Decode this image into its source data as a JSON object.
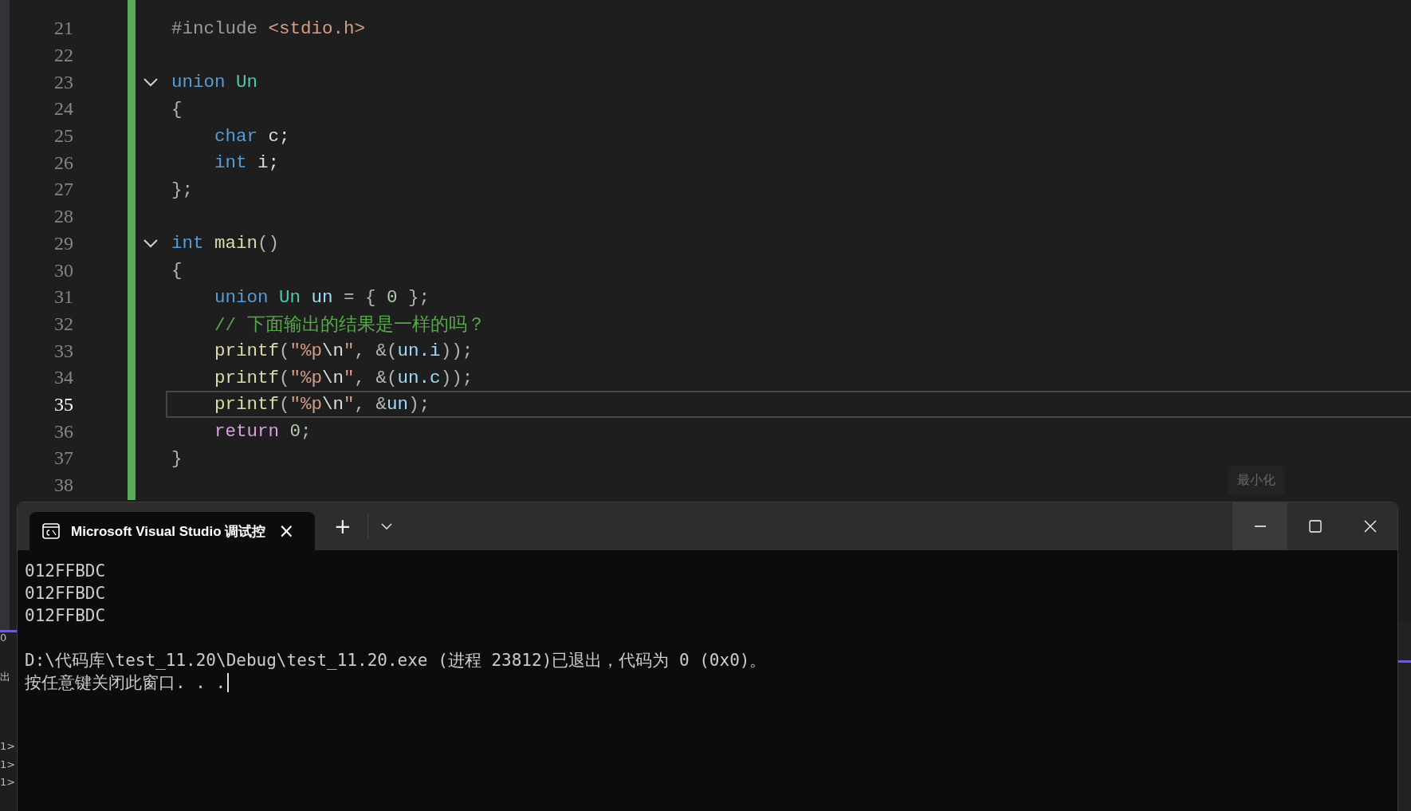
{
  "editor": {
    "lines": [
      {
        "number": "21",
        "current": false,
        "tokens": [
          {
            "kind": "preproc",
            "text": "#include "
          },
          {
            "kind": "string",
            "text": "<stdio.h>"
          }
        ]
      },
      {
        "number": "22",
        "current": false
      },
      {
        "number": "23",
        "current": false,
        "fold_expanded": true,
        "tokens": [
          {
            "kind": "keyword",
            "text": "union "
          },
          {
            "kind": "type",
            "text": "Un"
          }
        ]
      },
      {
        "number": "24",
        "current": false,
        "tokens": [
          {
            "kind": "punct",
            "text": "{"
          }
        ]
      },
      {
        "number": "25",
        "current": false,
        "tokens": [
          {
            "kind": "keyword",
            "text": "    char "
          },
          {
            "kind": "plain",
            "text": "c;"
          }
        ]
      },
      {
        "number": "26",
        "current": false,
        "tokens": [
          {
            "kind": "keyword",
            "text": "    int "
          },
          {
            "kind": "plain",
            "text": "i;"
          }
        ]
      },
      {
        "number": "27",
        "current": false,
        "tokens": [
          {
            "kind": "punct",
            "text": "};"
          }
        ]
      },
      {
        "number": "28",
        "current": false
      },
      {
        "number": "29",
        "current": false,
        "fold_expanded": true,
        "tokens": [
          {
            "kind": "keyword",
            "text": "int "
          },
          {
            "kind": "function",
            "text": "main"
          },
          {
            "kind": "punct",
            "text": "()"
          }
        ]
      },
      {
        "number": "30",
        "current": false,
        "tokens": [
          {
            "kind": "punct",
            "text": "{"
          }
        ]
      },
      {
        "number": "31",
        "current": false,
        "tokens": [
          {
            "kind": "keyword",
            "text": "    union "
          },
          {
            "kind": "type",
            "text": "Un "
          },
          {
            "kind": "variable",
            "text": "un"
          },
          {
            "kind": "punct",
            "text": " = { "
          },
          {
            "kind": "number",
            "text": "0"
          },
          {
            "kind": "punct",
            "text": " };"
          }
        ]
      },
      {
        "number": "32",
        "current": false,
        "tokens": [
          {
            "kind": "comment",
            "text": "    // 下面输出的结果是一样的吗？"
          }
        ]
      },
      {
        "number": "33",
        "current": false,
        "tokens": [
          {
            "kind": "function",
            "text": "    printf"
          },
          {
            "kind": "punct",
            "text": "("
          },
          {
            "kind": "string",
            "text": "\"%p"
          },
          {
            "kind": "plain",
            "text": "\\n"
          },
          {
            "kind": "string",
            "text": "\""
          },
          {
            "kind": "punct",
            "text": ", &("
          },
          {
            "kind": "variable",
            "text": "un.i"
          },
          {
            "kind": "punct",
            "text": "));"
          }
        ]
      },
      {
        "number": "34",
        "current": false,
        "tokens": [
          {
            "kind": "function",
            "text": "    printf"
          },
          {
            "kind": "punct",
            "text": "("
          },
          {
            "kind": "string",
            "text": "\"%p"
          },
          {
            "kind": "plain",
            "text": "\\n"
          },
          {
            "kind": "string",
            "text": "\""
          },
          {
            "kind": "punct",
            "text": ", &("
          },
          {
            "kind": "variable",
            "text": "un.c"
          },
          {
            "kind": "punct",
            "text": "));"
          }
        ]
      },
      {
        "number": "35",
        "current": true,
        "tokens": [
          {
            "kind": "function",
            "text": "    printf"
          },
          {
            "kind": "punct",
            "text": "("
          },
          {
            "kind": "string",
            "text": "\"%p"
          },
          {
            "kind": "plain",
            "text": "\\n"
          },
          {
            "kind": "string",
            "text": "\""
          },
          {
            "kind": "punct",
            "text": ", &"
          },
          {
            "kind": "variable",
            "text": "un"
          },
          {
            "kind": "punct",
            "text": ");"
          }
        ]
      },
      {
        "number": "36",
        "current": false,
        "tokens": [
          {
            "kind": "control",
            "text": "    return "
          },
          {
            "kind": "number",
            "text": "0"
          },
          {
            "kind": "punct",
            "text": ";"
          }
        ]
      },
      {
        "number": "37",
        "current": false,
        "tokens": [
          {
            "kind": "punct",
            "text": "}"
          }
        ]
      },
      {
        "number": "38",
        "current": false
      }
    ]
  },
  "output_panel": {
    "lines": [
      "0",
      "出",
      "1>",
      "1>",
      "1>"
    ]
  },
  "tooltip": "最小化",
  "terminal": {
    "tab": {
      "title": "Microsoft Visual Studio 调试控",
      "close": "×"
    },
    "new_tab": "+",
    "window_buttons": [
      {
        "kind": "minimize",
        "hovered": true
      },
      {
        "kind": "maximize",
        "hovered": false
      },
      {
        "kind": "close",
        "hovered": false
      }
    ],
    "output": [
      [
        "012FFBDC",
        "012FFBDC",
        "012FFBDC"
      ],
      [
        "D:\\代码库\\test_11.20\\Debug\\test_11.20.exe (进程 23812)已退出，代码为 0 (0x0)。",
        "按任意键关闭此窗口. . ."
      ]
    ]
  }
}
